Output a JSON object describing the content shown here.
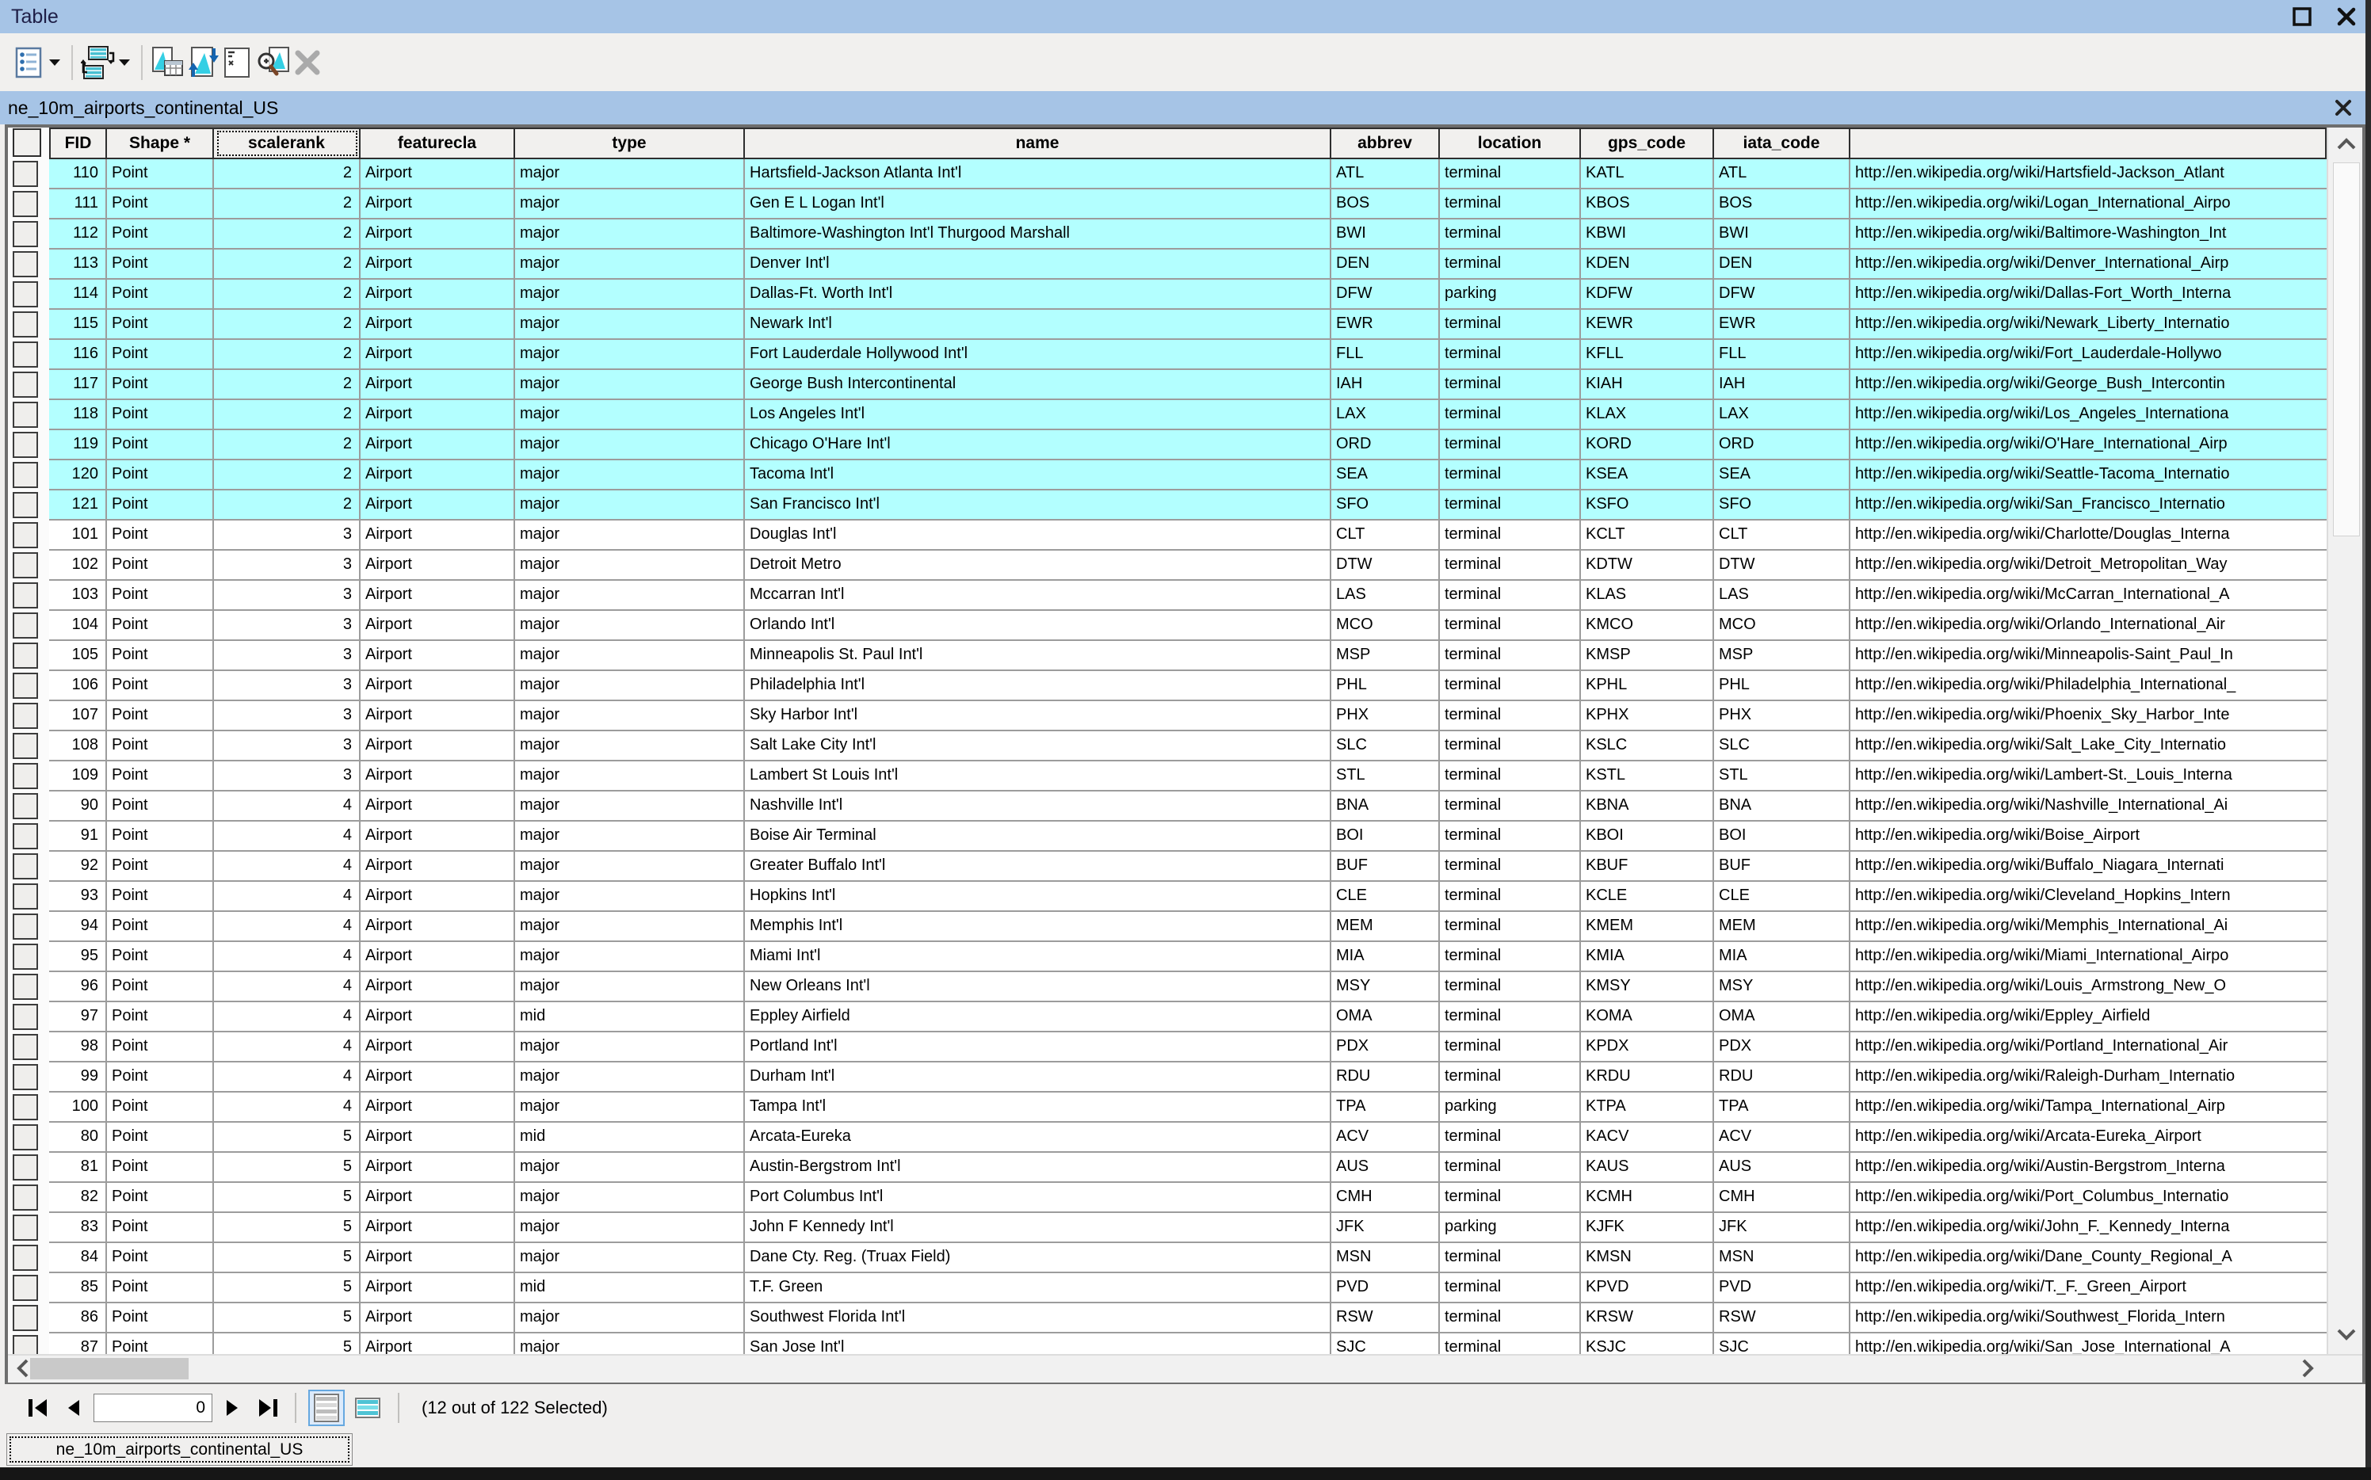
{
  "window": {
    "title": "Table"
  },
  "tabbar": {
    "label": "ne_10m_airports_continental_US"
  },
  "toolbar": {
    "icons": [
      "table-options-icon",
      "related-tables-icon",
      "select-by-attributes-icon",
      "switch-selection-icon",
      "clear-selection-icon",
      "zoom-to-selected-icon",
      "delete-selected-icon"
    ]
  },
  "table": {
    "columns": [
      {
        "key": "fid",
        "label": "FID"
      },
      {
        "key": "shape",
        "label": "Shape *"
      },
      {
        "key": "scalerank",
        "label": "scalerank"
      },
      {
        "key": "featurecla",
        "label": "featurecla"
      },
      {
        "key": "type",
        "label": "type"
      },
      {
        "key": "name",
        "label": "name"
      },
      {
        "key": "abbrev",
        "label": "abbrev"
      },
      {
        "key": "location",
        "label": "location"
      },
      {
        "key": "gps_code",
        "label": "gps_code"
      },
      {
        "key": "iata_code",
        "label": "iata_code"
      },
      {
        "key": "url",
        "label": ""
      }
    ],
    "rows": [
      [
        "110",
        "Point",
        "2",
        "Airport",
        "major",
        "Hartsfield-Jackson Atlanta Int'l",
        "ATL",
        "terminal",
        "KATL",
        "ATL",
        "http://en.wikipedia.org/wiki/Hartsfield-Jackson_Atlant",
        1
      ],
      [
        "111",
        "Point",
        "2",
        "Airport",
        "major",
        "Gen E L Logan Int'l",
        "BOS",
        "terminal",
        "KBOS",
        "BOS",
        "http://en.wikipedia.org/wiki/Logan_International_Airpo",
        1
      ],
      [
        "112",
        "Point",
        "2",
        "Airport",
        "major",
        "Baltimore-Washington Int'l Thurgood Marshall",
        "BWI",
        "terminal",
        "KBWI",
        "BWI",
        "http://en.wikipedia.org/wiki/Baltimore-Washington_Int",
        1
      ],
      [
        "113",
        "Point",
        "2",
        "Airport",
        "major",
        "Denver Int'l",
        "DEN",
        "terminal",
        "KDEN",
        "DEN",
        "http://en.wikipedia.org/wiki/Denver_International_Airp",
        1
      ],
      [
        "114",
        "Point",
        "2",
        "Airport",
        "major",
        "Dallas-Ft. Worth Int'l",
        "DFW",
        "parking",
        "KDFW",
        "DFW",
        "http://en.wikipedia.org/wiki/Dallas-Fort_Worth_Interna",
        1
      ],
      [
        "115",
        "Point",
        "2",
        "Airport",
        "major",
        "Newark Int'l",
        "EWR",
        "terminal",
        "KEWR",
        "EWR",
        "http://en.wikipedia.org/wiki/Newark_Liberty_Internatio",
        1
      ],
      [
        "116",
        "Point",
        "2",
        "Airport",
        "major",
        "Fort Lauderdale Hollywood Int'l",
        "FLL",
        "terminal",
        "KFLL",
        "FLL",
        "http://en.wikipedia.org/wiki/Fort_Lauderdale-Hollywo",
        1
      ],
      [
        "117",
        "Point",
        "2",
        "Airport",
        "major",
        "George Bush Intercontinental",
        "IAH",
        "terminal",
        "KIAH",
        "IAH",
        "http://en.wikipedia.org/wiki/George_Bush_Intercontin",
        1
      ],
      [
        "118",
        "Point",
        "2",
        "Airport",
        "major",
        "Los Angeles Int'l",
        "LAX",
        "terminal",
        "KLAX",
        "LAX",
        "http://en.wikipedia.org/wiki/Los_Angeles_Internationa",
        1
      ],
      [
        "119",
        "Point",
        "2",
        "Airport",
        "major",
        "Chicago O'Hare Int'l",
        "ORD",
        "terminal",
        "KORD",
        "ORD",
        "http://en.wikipedia.org/wiki/O'Hare_International_Airp",
        1
      ],
      [
        "120",
        "Point",
        "2",
        "Airport",
        "major",
        "Tacoma Int'l",
        "SEA",
        "terminal",
        "KSEA",
        "SEA",
        "http://en.wikipedia.org/wiki/Seattle-Tacoma_Internatio",
        1
      ],
      [
        "121",
        "Point",
        "2",
        "Airport",
        "major",
        "San Francisco Int'l",
        "SFO",
        "terminal",
        "KSFO",
        "SFO",
        "http://en.wikipedia.org/wiki/San_Francisco_Internatio",
        1
      ],
      [
        "101",
        "Point",
        "3",
        "Airport",
        "major",
        "Douglas Int'l",
        "CLT",
        "terminal",
        "KCLT",
        "CLT",
        "http://en.wikipedia.org/wiki/Charlotte/Douglas_Interna",
        0
      ],
      [
        "102",
        "Point",
        "3",
        "Airport",
        "major",
        "Detroit Metro",
        "DTW",
        "terminal",
        "KDTW",
        "DTW",
        "http://en.wikipedia.org/wiki/Detroit_Metropolitan_Way",
        0
      ],
      [
        "103",
        "Point",
        "3",
        "Airport",
        "major",
        "Mccarran Int'l",
        "LAS",
        "terminal",
        "KLAS",
        "LAS",
        "http://en.wikipedia.org/wiki/McCarran_International_A",
        0
      ],
      [
        "104",
        "Point",
        "3",
        "Airport",
        "major",
        "Orlando Int'l",
        "MCO",
        "terminal",
        "KMCO",
        "MCO",
        "http://en.wikipedia.org/wiki/Orlando_International_Air",
        0
      ],
      [
        "105",
        "Point",
        "3",
        "Airport",
        "major",
        "Minneapolis St. Paul Int'l",
        "MSP",
        "terminal",
        "KMSP",
        "MSP",
        "http://en.wikipedia.org/wiki/Minneapolis-Saint_Paul_In",
        0
      ],
      [
        "106",
        "Point",
        "3",
        "Airport",
        "major",
        "Philadelphia Int'l",
        "PHL",
        "terminal",
        "KPHL",
        "PHL",
        "http://en.wikipedia.org/wiki/Philadelphia_International_",
        0
      ],
      [
        "107",
        "Point",
        "3",
        "Airport",
        "major",
        "Sky Harbor Int'l",
        "PHX",
        "terminal",
        "KPHX",
        "PHX",
        "http://en.wikipedia.org/wiki/Phoenix_Sky_Harbor_Inte",
        0
      ],
      [
        "108",
        "Point",
        "3",
        "Airport",
        "major",
        "Salt Lake City Int'l",
        "SLC",
        "terminal",
        "KSLC",
        "SLC",
        "http://en.wikipedia.org/wiki/Salt_Lake_City_Internatio",
        0
      ],
      [
        "109",
        "Point",
        "3",
        "Airport",
        "major",
        "Lambert St Louis Int'l",
        "STL",
        "terminal",
        "KSTL",
        "STL",
        "http://en.wikipedia.org/wiki/Lambert-St._Louis_Interna",
        0
      ],
      [
        "90",
        "Point",
        "4",
        "Airport",
        "major",
        "Nashville Int'l",
        "BNA",
        "terminal",
        "KBNA",
        "BNA",
        "http://en.wikipedia.org/wiki/Nashville_International_Ai",
        0
      ],
      [
        "91",
        "Point",
        "4",
        "Airport",
        "major",
        "Boise Air Terminal",
        "BOI",
        "terminal",
        "KBOI",
        "BOI",
        "http://en.wikipedia.org/wiki/Boise_Airport",
        0
      ],
      [
        "92",
        "Point",
        "4",
        "Airport",
        "major",
        "Greater Buffalo Int'l",
        "BUF",
        "terminal",
        "KBUF",
        "BUF",
        "http://en.wikipedia.org/wiki/Buffalo_Niagara_Internati",
        0
      ],
      [
        "93",
        "Point",
        "4",
        "Airport",
        "major",
        "Hopkins Int'l",
        "CLE",
        "terminal",
        "KCLE",
        "CLE",
        "http://en.wikipedia.org/wiki/Cleveland_Hopkins_Intern",
        0
      ],
      [
        "94",
        "Point",
        "4",
        "Airport",
        "major",
        "Memphis Int'l",
        "MEM",
        "terminal",
        "KMEM",
        "MEM",
        "http://en.wikipedia.org/wiki/Memphis_International_Ai",
        0
      ],
      [
        "95",
        "Point",
        "4",
        "Airport",
        "major",
        "Miami Int'l",
        "MIA",
        "terminal",
        "KMIA",
        "MIA",
        "http://en.wikipedia.org/wiki/Miami_International_Airpo",
        0
      ],
      [
        "96",
        "Point",
        "4",
        "Airport",
        "major",
        "New Orleans Int'l",
        "MSY",
        "terminal",
        "KMSY",
        "MSY",
        "http://en.wikipedia.org/wiki/Louis_Armstrong_New_O",
        0
      ],
      [
        "97",
        "Point",
        "4",
        "Airport",
        "mid",
        "Eppley Airfield",
        "OMA",
        "terminal",
        "KOMA",
        "OMA",
        "http://en.wikipedia.org/wiki/Eppley_Airfield",
        0
      ],
      [
        "98",
        "Point",
        "4",
        "Airport",
        "major",
        "Portland Int'l",
        "PDX",
        "terminal",
        "KPDX",
        "PDX",
        "http://en.wikipedia.org/wiki/Portland_International_Air",
        0
      ],
      [
        "99",
        "Point",
        "4",
        "Airport",
        "major",
        "Durham Int'l",
        "RDU",
        "terminal",
        "KRDU",
        "RDU",
        "http://en.wikipedia.org/wiki/Raleigh-Durham_Internatio",
        0
      ],
      [
        "100",
        "Point",
        "4",
        "Airport",
        "major",
        "Tampa Int'l",
        "TPA",
        "parking",
        "KTPA",
        "TPA",
        "http://en.wikipedia.org/wiki/Tampa_International_Airp",
        0
      ],
      [
        "80",
        "Point",
        "5",
        "Airport",
        "mid",
        "Arcata-Eureka",
        "ACV",
        "terminal",
        "KACV",
        "ACV",
        "http://en.wikipedia.org/wiki/Arcata-Eureka_Airport",
        0
      ],
      [
        "81",
        "Point",
        "5",
        "Airport",
        "major",
        "Austin-Bergstrom Int'l",
        "AUS",
        "terminal",
        "KAUS",
        "AUS",
        "http://en.wikipedia.org/wiki/Austin-Bergstrom_Interna",
        0
      ],
      [
        "82",
        "Point",
        "5",
        "Airport",
        "major",
        "Port Columbus Int'l",
        "CMH",
        "terminal",
        "KCMH",
        "CMH",
        "http://en.wikipedia.org/wiki/Port_Columbus_Internatio",
        0
      ],
      [
        "83",
        "Point",
        "5",
        "Airport",
        "major",
        "John F Kennedy Int'l",
        "JFK",
        "parking",
        "KJFK",
        "JFK",
        "http://en.wikipedia.org/wiki/John_F._Kennedy_Interna",
        0
      ],
      [
        "84",
        "Point",
        "5",
        "Airport",
        "major",
        "Dane Cty. Reg. (Truax Field)",
        "MSN",
        "terminal",
        "KMSN",
        "MSN",
        "http://en.wikipedia.org/wiki/Dane_County_Regional_A",
        0
      ],
      [
        "85",
        "Point",
        "5",
        "Airport",
        "mid",
        "T.F. Green",
        "PVD",
        "terminal",
        "KPVD",
        "PVD",
        "http://en.wikipedia.org/wiki/T._F._Green_Airport",
        0
      ],
      [
        "86",
        "Point",
        "5",
        "Airport",
        "major",
        "Southwest Florida Int'l",
        "RSW",
        "terminal",
        "KRSW",
        "RSW",
        "http://en.wikipedia.org/wiki/Southwest_Florida_Intern",
        0
      ],
      [
        "87",
        "Point",
        "5",
        "Airport",
        "major",
        "San Jose Int'l",
        "SJC",
        "terminal",
        "KSJC",
        "SJC",
        "http://en.wikipedia.org/wiki/San_Jose_International_A",
        0
      ]
    ]
  },
  "statusbar": {
    "record_value": "0",
    "status_text": "(12 out of 122 Selected)"
  },
  "bottom_tab": {
    "label": "ne_10m_airports_continental_US"
  },
  "colors": {
    "selection_fill": "#b3ffff",
    "titlebar_blue": "#a6c4e6",
    "focus_blue": "#66a8e0"
  }
}
